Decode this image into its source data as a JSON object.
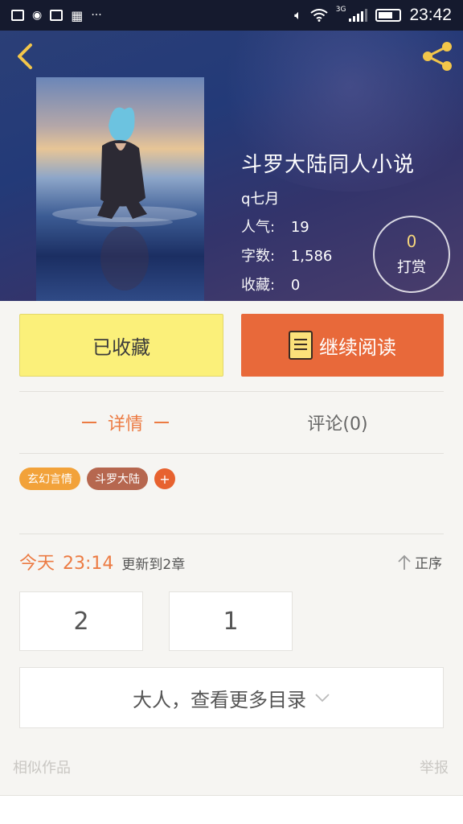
{
  "status_bar": {
    "clock": "23:42",
    "network": "3G",
    "more": "···"
  },
  "book": {
    "title": "斗罗大陆同人小说",
    "author": "q七月",
    "popularity_label": "人气:",
    "popularity": "19",
    "words_label": "字数:",
    "words": "1,586",
    "favorites_label": "收藏:",
    "favorites": "0"
  },
  "tip": {
    "count": "0",
    "label": "打赏"
  },
  "actions": {
    "collected_label": "已收藏",
    "continue_label": "继续阅读"
  },
  "tabs": {
    "details": "详情",
    "comments": "评论(0)"
  },
  "tags": [
    {
      "label": "玄幻言情",
      "color": "#f2a23a"
    },
    {
      "label": "斗罗大陆",
      "color": "#b6674f"
    }
  ],
  "tag_add": "+",
  "update": {
    "day": "今天",
    "time": "23:14",
    "text": "更新到2章",
    "order_label": "正序"
  },
  "chapters": [
    "2",
    "1"
  ],
  "more_catalog": "大人，查看更多目录",
  "footer": {
    "similar": "相似作品",
    "report": "举报"
  },
  "colors": {
    "accent": "#ec7b43",
    "collected_bg": "#fbf07a",
    "read_bg": "#e8693a"
  }
}
